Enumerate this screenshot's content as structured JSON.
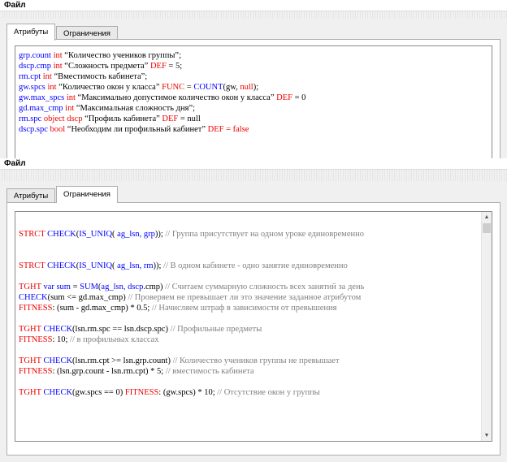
{
  "top": {
    "menu": "Файл",
    "tabs": [
      "Атрибуты",
      "Ограничения"
    ],
    "lines": [
      [
        [
          "grp.count ",
          "b"
        ],
        [
          "int",
          "r"
        ],
        [
          " “Количество учеников группы”;",
          "k"
        ]
      ],
      [
        [
          "dscp.cmp ",
          "b"
        ],
        [
          "int",
          "r"
        ],
        [
          " “Сложность предмета” ",
          "k"
        ],
        [
          "DEF",
          "r"
        ],
        [
          " = 5;",
          "k"
        ]
      ],
      [
        [
          "rm.cpt ",
          "b"
        ],
        [
          "int",
          "r"
        ],
        [
          " “Вместимость кабинета”;",
          "k"
        ]
      ],
      [
        [
          "gw.spcs ",
          "b"
        ],
        [
          "int",
          "r"
        ],
        [
          " “Количество окон у класса” ",
          "k"
        ],
        [
          "FUNC",
          "r"
        ],
        [
          " = ",
          "k"
        ],
        [
          "COUNT",
          "b"
        ],
        [
          "(gw, ",
          "k"
        ],
        [
          "null",
          "r"
        ],
        [
          ");",
          "k"
        ]
      ],
      [
        [
          "gw.max_spcs ",
          "b"
        ],
        [
          "int",
          "r"
        ],
        [
          " “Максимально допустимое количество окон у класса” ",
          "k"
        ],
        [
          "DEF",
          "r"
        ],
        [
          " = 0",
          "k"
        ]
      ],
      [
        [
          "gd.max_cmp ",
          "b"
        ],
        [
          "int",
          "r"
        ],
        [
          " “Максимальная сложность дня”;",
          "k"
        ]
      ],
      [
        [
          "rm.spc ",
          "b"
        ],
        [
          "object dscp",
          "r"
        ],
        [
          " “Профиль кабинета” ",
          "k"
        ],
        [
          "DEF",
          "r"
        ],
        [
          " = null",
          "k"
        ]
      ],
      [
        [
          "dscp.spc ",
          "b"
        ],
        [
          "bool",
          "r"
        ],
        [
          " “Необходим ли профильный кабинет” ",
          "k"
        ],
        [
          "DEF",
          "r"
        ],
        [
          " = false",
          "r"
        ]
      ]
    ]
  },
  "bottom": {
    "menu": "Файл",
    "tabs": [
      "Атрибуты",
      "Ограничения"
    ],
    "lines": [
      [],
      [
        [
          "STRCT ",
          "r"
        ],
        [
          "CHECK",
          "b"
        ],
        [
          "(",
          "k"
        ],
        [
          "IS_UNIQ",
          "b"
        ],
        [
          "( ",
          "k"
        ],
        [
          "ag_lsn, grp",
          "b"
        ],
        [
          "));",
          "k"
        ],
        [
          " // Группа присутствует на одном уроке единовременно",
          "c"
        ]
      ],
      [],
      [],
      [
        [
          "STRCT ",
          "r"
        ],
        [
          "CHECK",
          "b"
        ],
        [
          "(",
          "k"
        ],
        [
          "IS_UNIQ",
          "b"
        ],
        [
          "( ",
          "k"
        ],
        [
          "ag_lsn, rm",
          "b"
        ],
        [
          "));",
          "k"
        ],
        [
          " // В одном кабинете - одно занятие единовременно",
          "c"
        ]
      ],
      [],
      [
        [
          "TGHT ",
          "r"
        ],
        [
          "var sum",
          "b"
        ],
        [
          " = ",
          "k"
        ],
        [
          "SUM",
          "b"
        ],
        [
          "(",
          "k"
        ],
        [
          "ag_lsn, dscp",
          "b"
        ],
        [
          ".cmp)",
          "k"
        ],
        [
          " // Считаем суммарную сложность всех занятий за день",
          "c"
        ]
      ],
      [
        [
          "CHECK",
          "b"
        ],
        [
          "(sum <= gd.max_cmp)",
          "k"
        ],
        [
          " // Проверяем не превышает ли это значение заданное атрибутом",
          "c"
        ]
      ],
      [
        [
          "FITNESS",
          "r"
        ],
        [
          ": (sum - gd.max_cmp) * 0.5;",
          "k"
        ],
        [
          " // Начисляем штраф в зависимости от превышения",
          "c"
        ]
      ],
      [],
      [
        [
          "TGHT ",
          "r"
        ],
        [
          "CHECK",
          "b"
        ],
        [
          "(lsn.rm.spc == lsn.dscp.spc)",
          "k"
        ],
        [
          " // Профильные предметы",
          "c"
        ]
      ],
      [
        [
          "FITNESS",
          "r"
        ],
        [
          ": 10;",
          "k"
        ],
        [
          " // в профильных классах",
          "c"
        ]
      ],
      [],
      [
        [
          "TGHT ",
          "r"
        ],
        [
          "CHECK",
          "b"
        ],
        [
          "(lsn.rm.cpt >= lsn.grp.count)",
          "k"
        ],
        [
          " // Количество учеников группы не превышает",
          "c"
        ]
      ],
      [
        [
          "FITNESS",
          "r"
        ],
        [
          ": (lsn.grp.count - lsn.rm.cpt) * 5;",
          "k"
        ],
        [
          " // вместимость кабинета",
          "c"
        ]
      ],
      [],
      [
        [
          "TGHT ",
          "r"
        ],
        [
          "CHECK",
          "b"
        ],
        [
          "(gw.spcs == 0) ",
          "k"
        ],
        [
          "FITNESS",
          "r"
        ],
        [
          ": (gw.spcs) * 10;",
          "k"
        ],
        [
          " // Отсутствие окон у группы",
          "c"
        ]
      ]
    ]
  },
  "icons": {
    "scroll_up": "arrow-up-icon",
    "scroll_down": "arrow-down-icon"
  },
  "colors": {
    "keyword_blue": "#0000ff",
    "keyword_red": "#ee0000",
    "comment": "#808080"
  }
}
